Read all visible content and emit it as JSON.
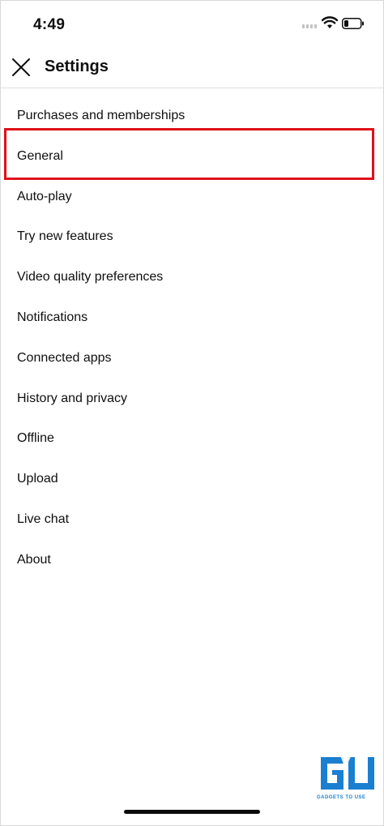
{
  "status_bar": {
    "time": "4:49"
  },
  "header": {
    "title": "Settings"
  },
  "settings_items": [
    "Purchases and memberships",
    "General",
    "Auto-play",
    "Try new features",
    "Video quality preferences",
    "Notifications",
    "Connected apps",
    "History and privacy",
    "Offline",
    "Upload",
    "Live chat",
    "About"
  ],
  "highlight": {
    "target": "General",
    "color": "#e01019"
  },
  "watermark": {
    "text": "GADGETS TO USE",
    "color": "#1b7fd1"
  },
  "icons": {
    "close": "close-icon",
    "wifi": "wifi-icon",
    "battery": "battery-icon",
    "signal": "cellular-signal-icon"
  }
}
